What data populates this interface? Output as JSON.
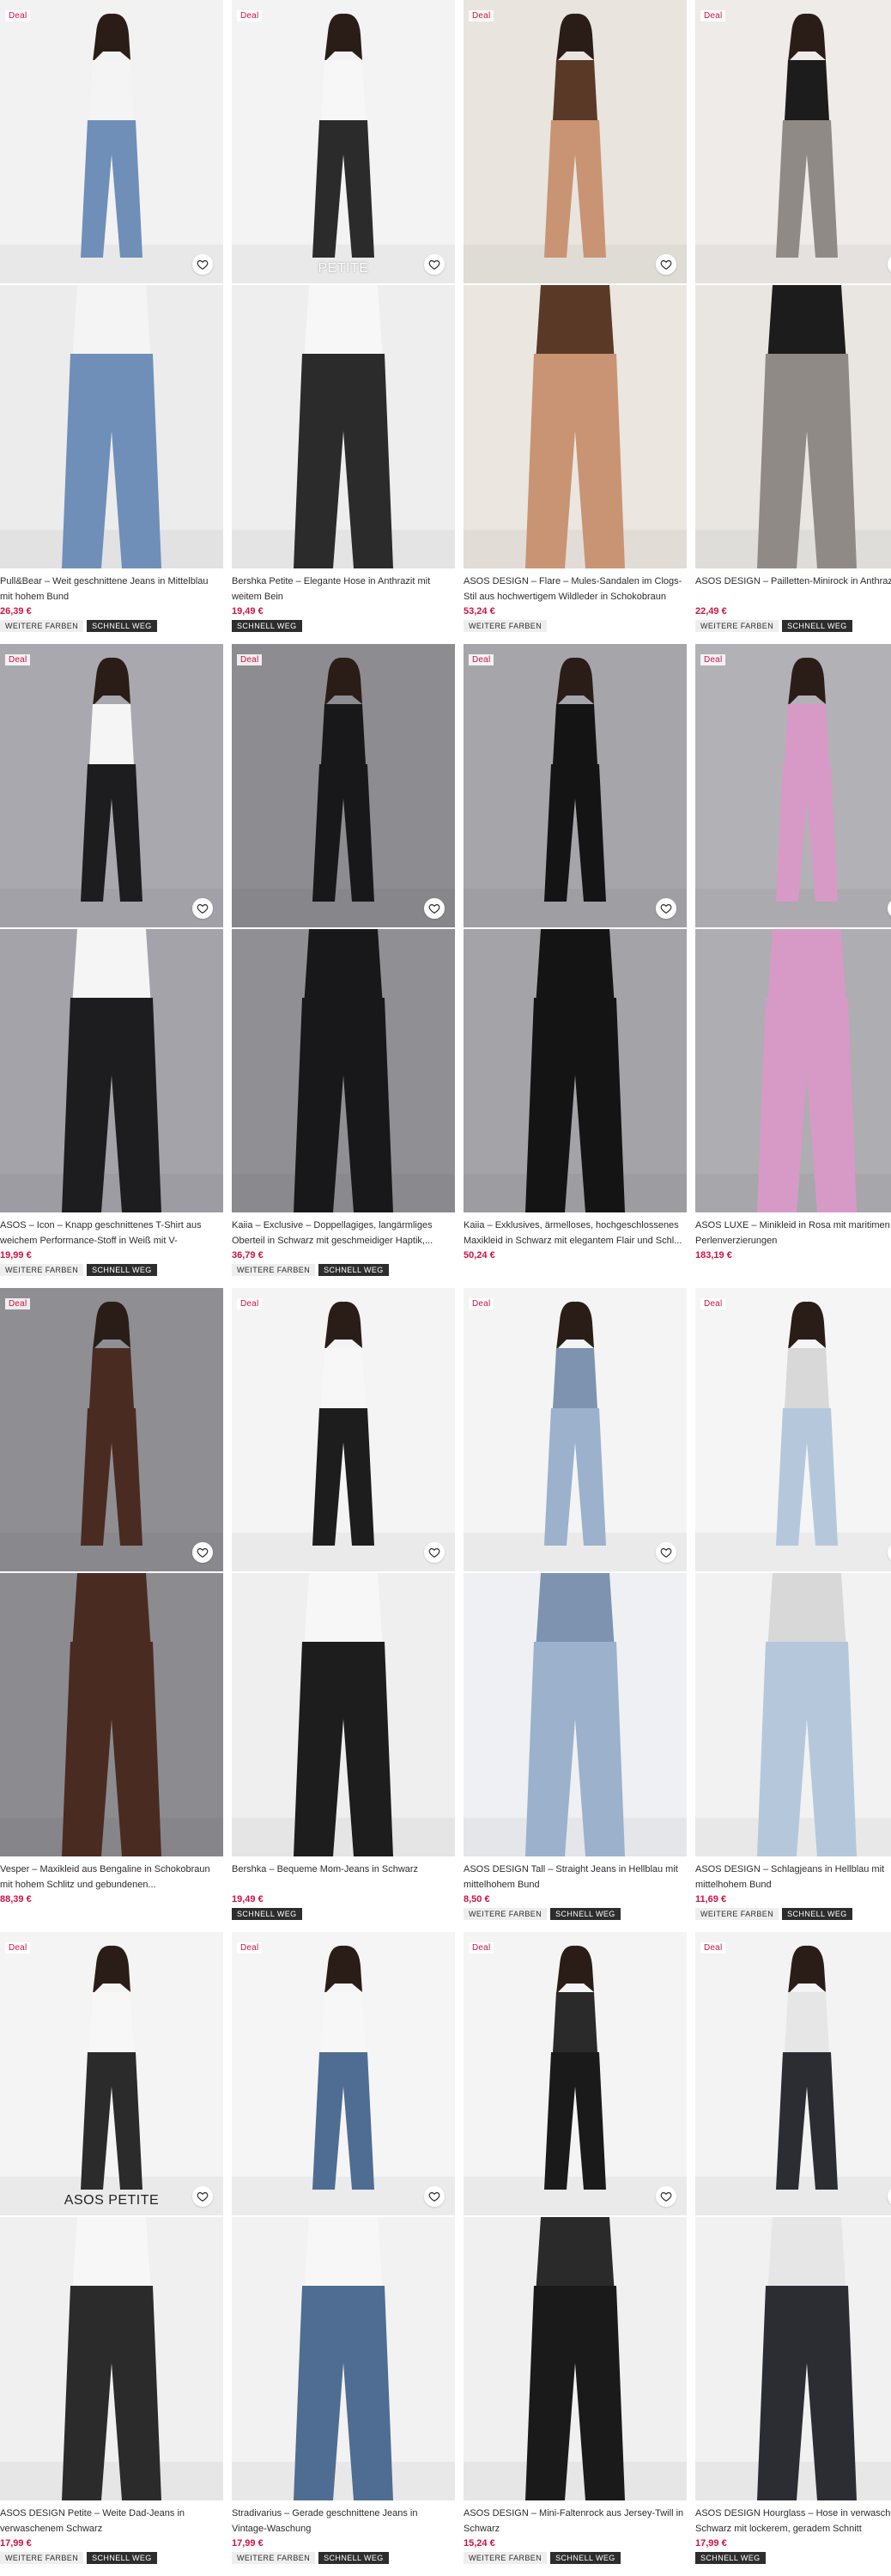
{
  "heart_icon": "heart-outline-icon",
  "colors": {
    "price": "#d01345",
    "deal": "#d01345",
    "tag_dark": "#2d2d2d",
    "tag_light": "#eeeeee"
  },
  "products": [
    {
      "deal": "Deal",
      "title": "Pull&Bear – Weit geschnittene Jeans in Mittelblau mit hohem Bund",
      "price": "26,39 €",
      "tags": [
        "WEITERE FARBEN",
        "SCHNELL WEG"
      ],
      "badge": ""
    },
    {
      "deal": "Deal",
      "title": "Bershka Petite – Elegante Hose in Anthrazit mit weitem Bein",
      "price": "19,49 €",
      "tags": [
        "SCHNELL WEG"
      ],
      "badge": "PETITE"
    },
    {
      "deal": "Deal",
      "title": "ASOS DESIGN – Flare – Mules-Sandalen im Clogs-Stil aus hochwertigem Wildleder in Schokobraun",
      "price": "53,24 €",
      "tags": [
        "WEITERE FARBEN"
      ],
      "badge": ""
    },
    {
      "deal": "Deal",
      "title": "ASOS DESIGN – Pailletten-Minirock in Anthrazit",
      "price": "22,49 €",
      "tags": [
        "WEITERE FARBEN",
        "SCHNELL WEG"
      ],
      "badge": ""
    },
    {
      "deal": "Deal",
      "title": "ASOS – Icon – Knapp geschnittenes T-Shirt aus weichem Performance-Stoff in Weiß mit V-Ausschni...",
      "price": "19,99 €",
      "tags": [
        "WEITERE FARBEN",
        "SCHNELL WEG"
      ],
      "badge": ""
    },
    {
      "deal": "Deal",
      "title": "Kaiia – Exclusive – Doppellagiges, langärmliges Oberteil in Schwarz mit geschmeidiger Haptik,...",
      "price": "36,79 €",
      "tags": [
        "WEITERE FARBEN",
        "SCHNELL WEG"
      ],
      "badge": ""
    },
    {
      "deal": "Deal",
      "title": "Kaiia – Exklusives, ärmelloses, hochgeschlossenes Maxikleid in Schwarz mit elegantem Flair und Schl...",
      "price": "50,24 €",
      "tags": [],
      "badge": ""
    },
    {
      "deal": "Deal",
      "title": "ASOS LUXE – Minikleid in Rosa mit maritimen Perlenverzierungen",
      "price": "183,19 €",
      "tags": [],
      "badge": ""
    },
    {
      "deal": "Deal",
      "title": "Vesper – Maxikleid aus Bengaline in Schokobraun mit hohem Schlitz und gebundenen...",
      "price": "88,39 €",
      "tags": [],
      "badge": ""
    },
    {
      "deal": "Deal",
      "title": "Bershka – Bequeme Mom-Jeans in Schwarz",
      "price": "19,49 €",
      "tags": [
        "SCHNELL WEG"
      ],
      "badge": ""
    },
    {
      "deal": "Deal",
      "title": "ASOS DESIGN Tall – Straight Jeans in Hellblau mit mittelhohem Bund",
      "price": "8,50 €",
      "tags": [
        "WEITERE FARBEN",
        "SCHNELL WEG"
      ],
      "badge": ""
    },
    {
      "deal": "Deal",
      "title": "ASOS DESIGN – Schlagjeans in Hellblau mit mittelhohem Bund",
      "price": "11,69 €",
      "tags": [
        "WEITERE FARBEN",
        "SCHNELL WEG"
      ],
      "badge": ""
    },
    {
      "deal": "Deal",
      "title": "ASOS DESIGN Petite – Weite Dad-Jeans in verwaschenem Schwarz",
      "price": "17,99 €",
      "tags": [
        "WEITERE FARBEN",
        "SCHNELL WEG"
      ],
      "badge": "ASOS PETITE"
    },
    {
      "deal": "Deal",
      "title": "Stradivarius – Gerade geschnittene Jeans in Vintage-Waschung",
      "price": "17,99 €",
      "tags": [
        "WEITERE FARBEN",
        "SCHNELL WEG"
      ],
      "badge": ""
    },
    {
      "deal": "Deal",
      "title": "ASOS DESIGN – Mini-Faltenrock aus Jersey-Twill in Schwarz",
      "price": "15,24 €",
      "tags": [
        "WEITERE FARBEN",
        "SCHNELL WEG"
      ],
      "badge": ""
    },
    {
      "deal": "Deal",
      "title": "ASOS DESIGN Hourglass – Hose in verwaschenem Schwarz mit lockerem, geradem Schnitt",
      "price": "17,99 €",
      "tags": [
        "SCHNELL WEG"
      ],
      "badge": ""
    }
  ]
}
